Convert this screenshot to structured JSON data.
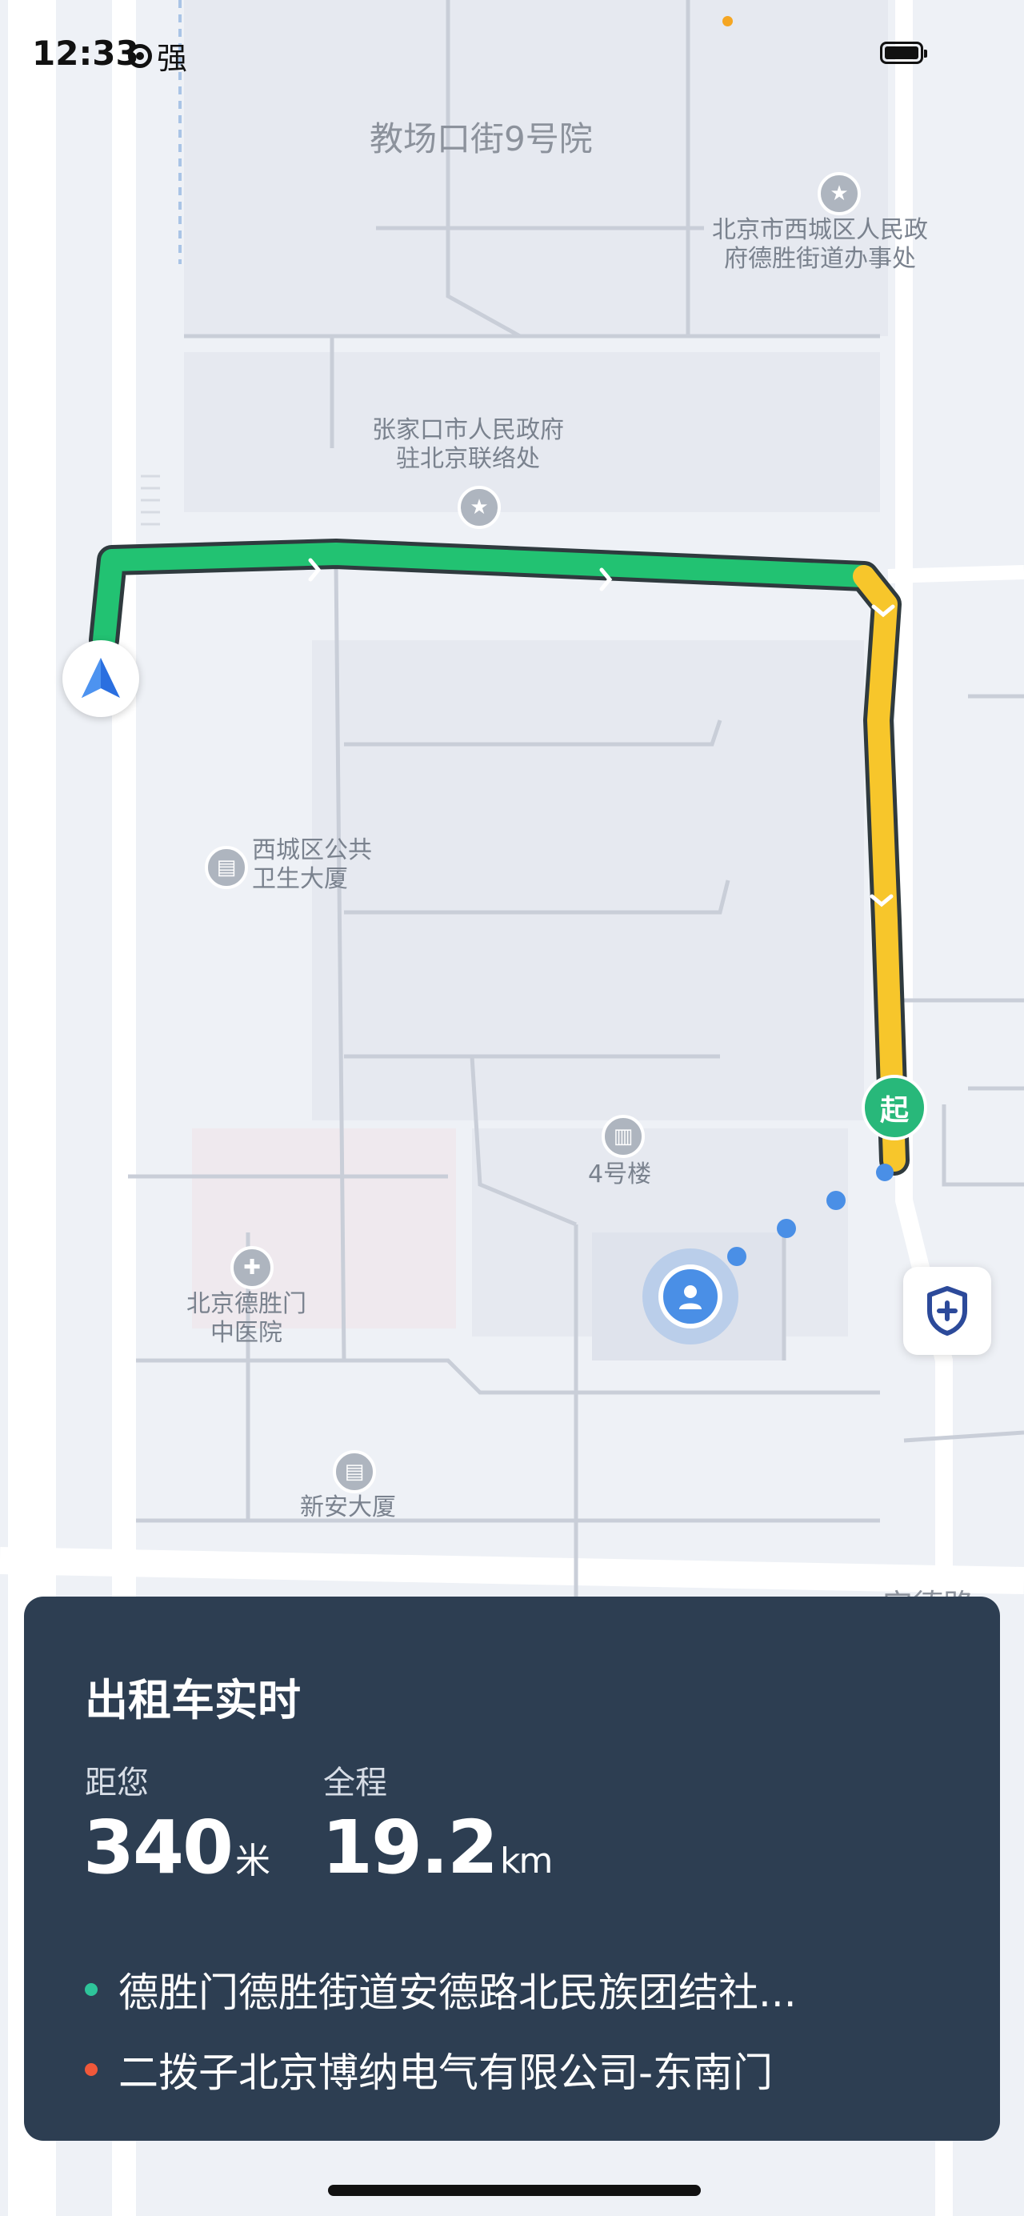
{
  "status_bar": {
    "time": "12:33",
    "signal_label": "强"
  },
  "map": {
    "road_label": "安德路",
    "pois": [
      {
        "name": "jiaochangkou",
        "label": "教场口街9号院"
      },
      {
        "name": "xicheng-gov",
        "label": "北京市西城区人民政\n府德胜街道办事处"
      },
      {
        "name": "zhangjiakou-office",
        "label": "张家口市人民政府\n驻北京联络处"
      },
      {
        "name": "health-building",
        "label": "西城区公共\n卫生大厦"
      },
      {
        "name": "building-4",
        "label": "4号楼"
      },
      {
        "name": "deshengmen-hospital",
        "label": "北京德胜门\n中医院"
      },
      {
        "name": "xinan-building",
        "label": "新安大厦"
      }
    ],
    "start_marker": "起",
    "colors": {
      "route_green": "#22c272",
      "route_yellow": "#f7c62b",
      "route_outline": "#3a3a3a",
      "user_blue": "#4a8fe6"
    }
  },
  "panel": {
    "title": "出租车实时",
    "distance_label": "距您",
    "distance_value": "340",
    "distance_unit": "米",
    "total_label": "全程",
    "total_value": "19.2",
    "total_unit": "km",
    "origin": "德胜门德胜街道安德路北民族团结社...",
    "destination": "二拨子北京博纳电气有限公司-东南门",
    "origin_color": "#2ec49a",
    "destination_color": "#f0583a"
  }
}
